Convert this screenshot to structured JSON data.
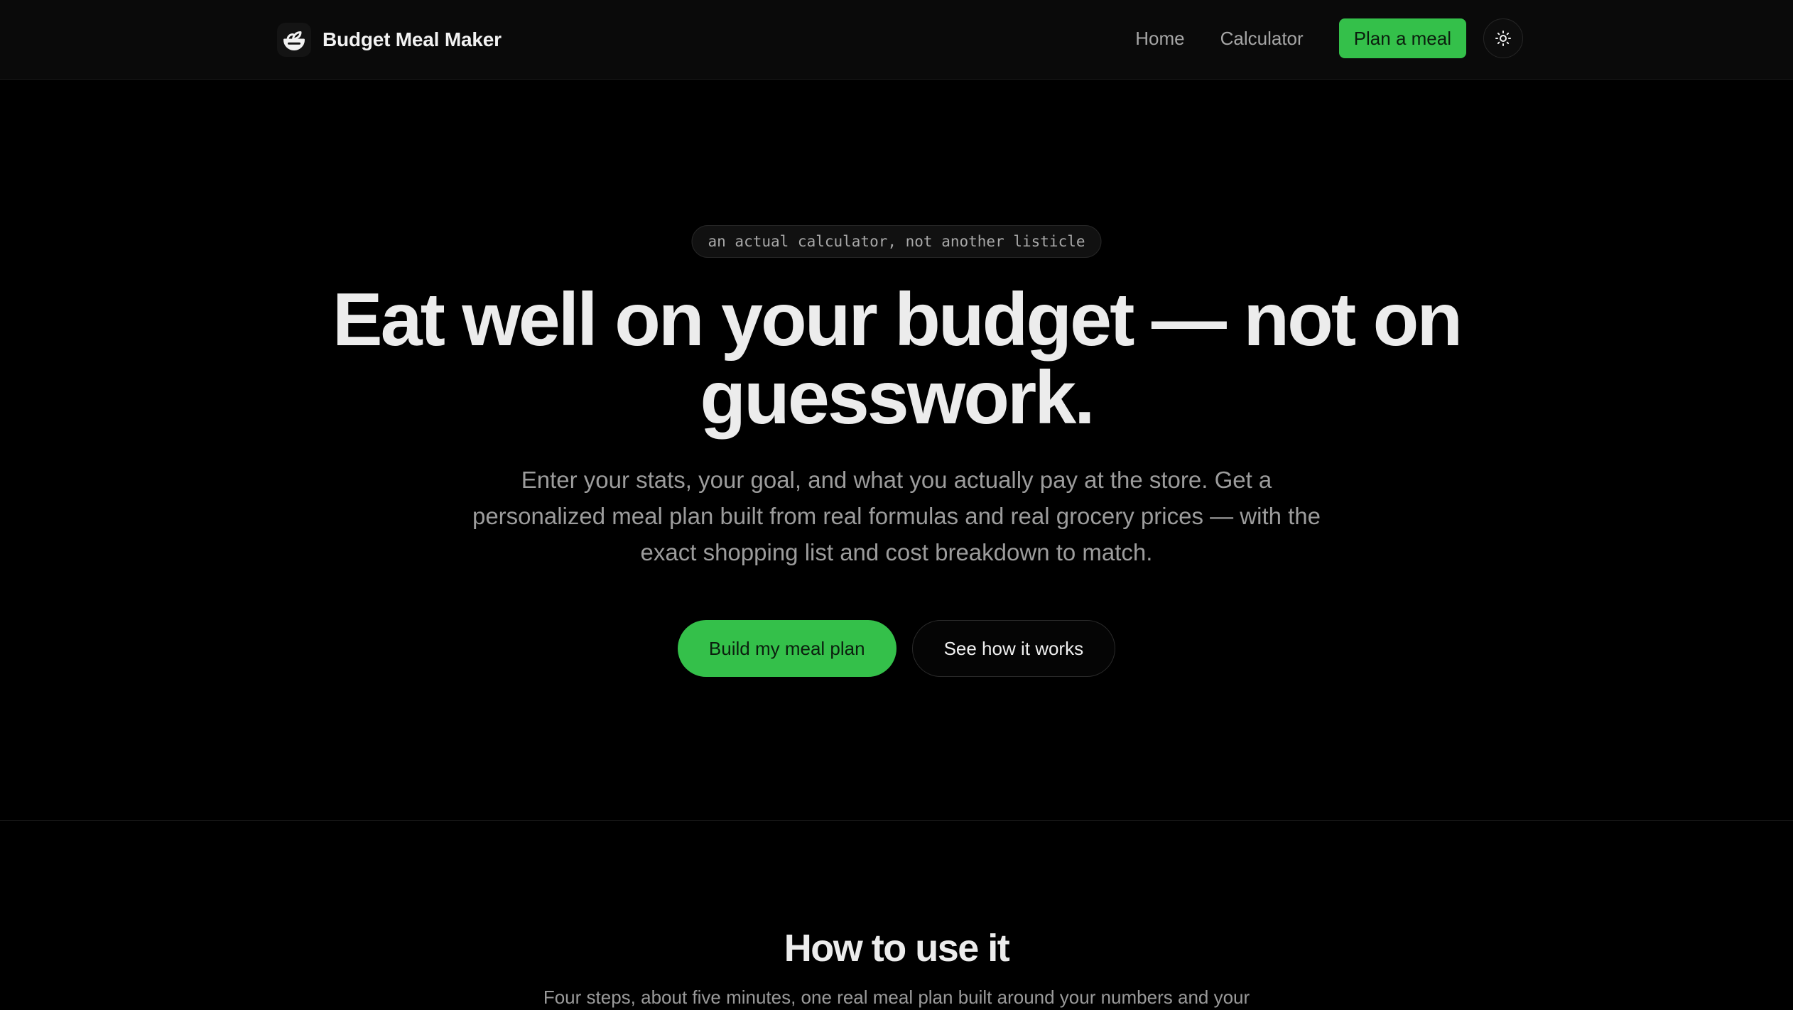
{
  "header": {
    "brand_name": "Budget Meal Maker",
    "logo_icon": "salad-bowl-icon",
    "nav": {
      "home_label": "Home",
      "calculator_label": "Calculator",
      "cta_label": "Plan a meal"
    },
    "theme_toggle_icon": "sun-icon"
  },
  "hero": {
    "tagline": "an actual calculator, not another listicle",
    "title_line_1": "Eat well on your budget — not on",
    "title_line_2": "guesswork.",
    "subtitle_line_1": "Enter your stats, your goal, and what you actually pay at the store. Get a",
    "subtitle_line_2": "personalized meal plan built from real formulas and real grocery prices — with the",
    "subtitle_line_3": "exact shopping list and cost breakdown to match.",
    "primary_button_label": "Build my meal plan",
    "secondary_button_label": "See how it works"
  },
  "how_to": {
    "title": "How to use it",
    "subtitle": "Four steps, about five minutes, one real meal plan built around your numbers and your"
  },
  "colors": {
    "accent": "#34c04a",
    "background": "#000000",
    "header_background": "#0a0a0a"
  }
}
